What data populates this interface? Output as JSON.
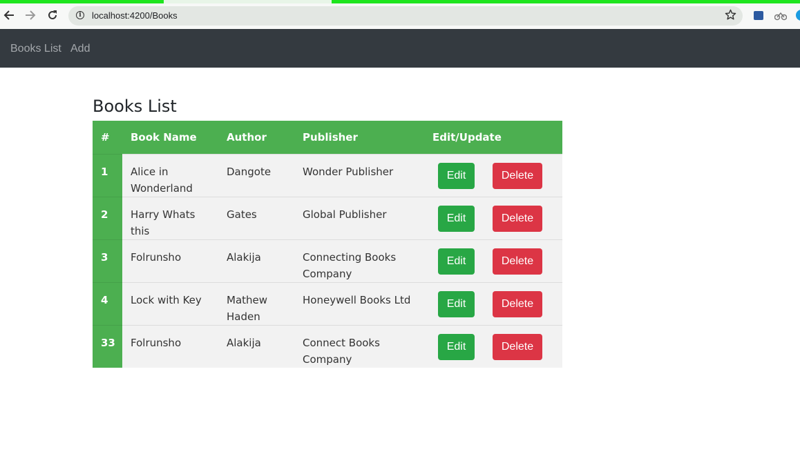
{
  "browser": {
    "url": "localhost:4200/Books",
    "back_icon": "back-arrow-icon",
    "forward_icon": "forward-arrow-icon",
    "reload_icon": "reload-icon",
    "info_icon": "info-icon",
    "star_icon": "bookmark-star-icon",
    "accent_color": "#1ee51e"
  },
  "navbar": {
    "items": [
      {
        "label": "Books List"
      },
      {
        "label": "Add"
      }
    ],
    "background": "#343a40"
  },
  "page": {
    "title": "Books List"
  },
  "table": {
    "headers": [
      "#",
      "Book Name",
      "Author",
      "Publisher",
      "Edit/Update"
    ],
    "header_color": "#4caf50",
    "rows": [
      {
        "id": "1",
        "book_name": "Alice in Wonderland",
        "author": "Dangote",
        "publisher": "Wonder Publisher"
      },
      {
        "id": "2",
        "book_name": "Harry Whats this",
        "author": "Gates",
        "publisher": "Global Publisher"
      },
      {
        "id": "3",
        "book_name": "Folrunsho",
        "author": "Alakija",
        "publisher": "Connecting Books Company"
      },
      {
        "id": "4",
        "book_name": "Lock with Key",
        "author": "Mathew Haden",
        "publisher": "Honeywell Books Ltd"
      },
      {
        "id": "33",
        "book_name": "Folrunsho",
        "author": "Alakija",
        "publisher": "Connect Books Company"
      }
    ],
    "edit_label": "Edit",
    "delete_label": "Delete",
    "edit_color": "#28a745",
    "delete_color": "#dc3545"
  }
}
